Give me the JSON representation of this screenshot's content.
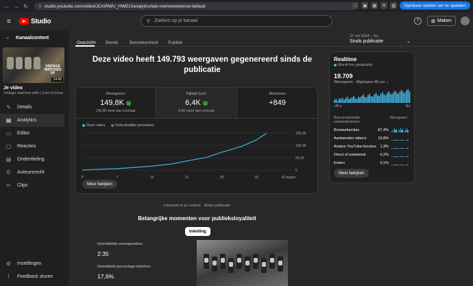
{
  "browser": {
    "url": "studio.youtube.com/video/JCmRWU_HWEU/analytics/tab-overview/period-default",
    "update_label": "Opnieuw starten om te updaten"
  },
  "topbar": {
    "logo_text": "Studio",
    "search_placeholder": "Zoeken op je kanaal",
    "create_label": "Maken"
  },
  "sidebar": {
    "back_title": "Kanaalcontent",
    "thumb_text": "VINTAGE WATCHES OF",
    "thumb_duration": "14:40",
    "video_label": "Je video",
    "video_subtitle": "Vintage watches with ( a lot of (char...",
    "items": [
      {
        "label": "Details",
        "icon": "pencil-icon",
        "glyph": "✎"
      },
      {
        "label": "Analytics",
        "icon": "analytics-icon",
        "glyph": "▤"
      },
      {
        "label": "Editor",
        "icon": "editor-icon",
        "glyph": "▭"
      },
      {
        "label": "Reacties",
        "icon": "comments-icon",
        "glyph": "▢"
      },
      {
        "label": "Ondertiteling",
        "icon": "subtitles-icon",
        "glyph": "▤"
      },
      {
        "label": "Auteursrecht",
        "icon": "copyright-icon",
        "glyph": "©"
      },
      {
        "label": "Clips",
        "icon": "clips-icon",
        "glyph": "✂"
      }
    ],
    "bottom": [
      {
        "label": "Instellingen",
        "icon": "gear-icon",
        "glyph": "⚙"
      },
      {
        "label": "Feedback sturen",
        "icon": "feedback-icon",
        "glyph": "!"
      }
    ]
  },
  "tabs": [
    "Overzicht",
    "Bereik",
    "Betrokkenheid",
    "Publiek"
  ],
  "period": {
    "date": "27 okt 2024 – Nu",
    "label": "Sinds publicatie"
  },
  "headline": "Deze video heeft 149.793 weergaven gegenereerd sinds de publicatie",
  "metrics": [
    {
      "label": "Weergaven",
      "value": "149,8K",
      "sub": "148,6K meer dan normaal"
    },
    {
      "label": "Kijktijd (uur)",
      "value": "6,4K",
      "sub": "6,4K meer dan normaal"
    },
    {
      "label": "Abonnees",
      "value": "+849",
      "sub": ""
    }
  ],
  "legend": {
    "series": "Deze video",
    "typical": "Gebruikelijke prestaties"
  },
  "chart_data": {
    "type": "line",
    "x": [
      0,
      3,
      7,
      10,
      14,
      18,
      21,
      25,
      28,
      32,
      35,
      37
    ],
    "series": [
      {
        "name": "Deze video",
        "values": [
          0,
          3000,
          6000,
          10000,
          16000,
          25000,
          37000,
          52000,
          72000,
          96000,
          122000,
          149793
        ]
      }
    ],
    "xticks": [
      "0",
      "7",
      "14",
      "21",
      "28",
      "35",
      "42 dagen"
    ],
    "xtick_values": [
      0,
      7,
      14,
      21,
      28,
      35,
      42
    ],
    "yticks": [
      "150,0K",
      "100,0K",
      "50,0K",
      "0"
    ],
    "ytick_values": [
      150000,
      100000,
      50000,
      0
    ],
    "xlim": [
      0,
      42
    ],
    "ylim": [
      0,
      150000
    ],
    "color": "#41b4e6"
  },
  "more_label": "Meer bekijken",
  "realtime": {
    "title": "Realtime",
    "live": "Wordt live geüpdatet",
    "value": "19.709",
    "sub": "Weergaven · Afgelopen 48 uur",
    "axis_left": "-48 u",
    "axis_right": "Nu",
    "sources_header": "Best presterende verkeersbronnen",
    "views_header": "Weergaven",
    "hourly": [
      4,
      5,
      3,
      6,
      5,
      7,
      4,
      6,
      8,
      5,
      6,
      7,
      9,
      6,
      5,
      8,
      7,
      9,
      11,
      8,
      7,
      10,
      12,
      9,
      8,
      11,
      13,
      10,
      9,
      12,
      14,
      11,
      10,
      13,
      15,
      12,
      11,
      14,
      16,
      13,
      12,
      15,
      17,
      14,
      13,
      16,
      18,
      15
    ],
    "sources": [
      {
        "name": "Browsefuncties",
        "pct": "87,4%"
      },
      {
        "name": "Aanbevolen video's",
        "pct": "10,8%"
      },
      {
        "name": "Andere YouTube-functies",
        "pct": "1,3%"
      },
      {
        "name": "Direct of onbekend",
        "pct": "0,2%"
      },
      {
        "name": "Extern",
        "pct": "0,1%"
      }
    ]
  },
  "moments": {
    "sub": "Interesse in je content · Sinds publicatie",
    "title": "Belangrijke momenten voor publieksloyaliteit",
    "chip": "Inleiding",
    "avg_duration_label": "Gemiddelde weergaveduur",
    "avg_duration": "2:35",
    "avg_pct_label": "Gemiddeld percentage bekeken",
    "avg_pct": "17,6%"
  },
  "colors": {
    "accent": "#41b4e6",
    "positive": "#2ba640",
    "update": "#1a73e8",
    "youtube": "#ff0000"
  }
}
